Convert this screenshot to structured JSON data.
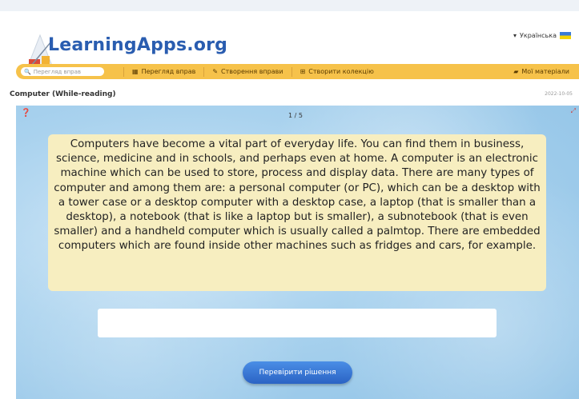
{
  "header": {
    "logo": "LearningApps.org",
    "language": "Українська"
  },
  "toolbar": {
    "search_placeholder": "Перегляд вправ",
    "browse_label": "Перегляд вправ",
    "create_label": "Створення вправи",
    "collection_label": "Створити колекцію",
    "materials_label": "Мої матеріали"
  },
  "exercise": {
    "title": "Computer (While-reading)",
    "date": "2022-10-05",
    "counter": "1 / 5",
    "text": "Computers have become a vital part of everyday life. You can find them in business, science, medicine and in schools, and perhaps even at home. A computer is an electronic machine which can be used to store, process and display data. There are many types of computer and among them are: a personal computer (or PC), which can be a desktop with a tower case or a desktop computer with a desktop case, a laptop (that is smaller than a desktop), a notebook (that is like a laptop but is smaller), a subnotebook (that is even smaller) and a handheld computer which is usually called a palmtop. There are embedded computers which are found inside other machines such as fridges and cars, for example.",
    "answer_value": "",
    "check_label": "Перевірити рішення"
  },
  "icons": {
    "search": "search-icon",
    "grid": "grid-icon",
    "pencil": "pencil-icon",
    "collection": "collection-icon",
    "folder": "folder-icon",
    "hint": "hint-icon",
    "fullscreen": "fullscreen-icon"
  }
}
